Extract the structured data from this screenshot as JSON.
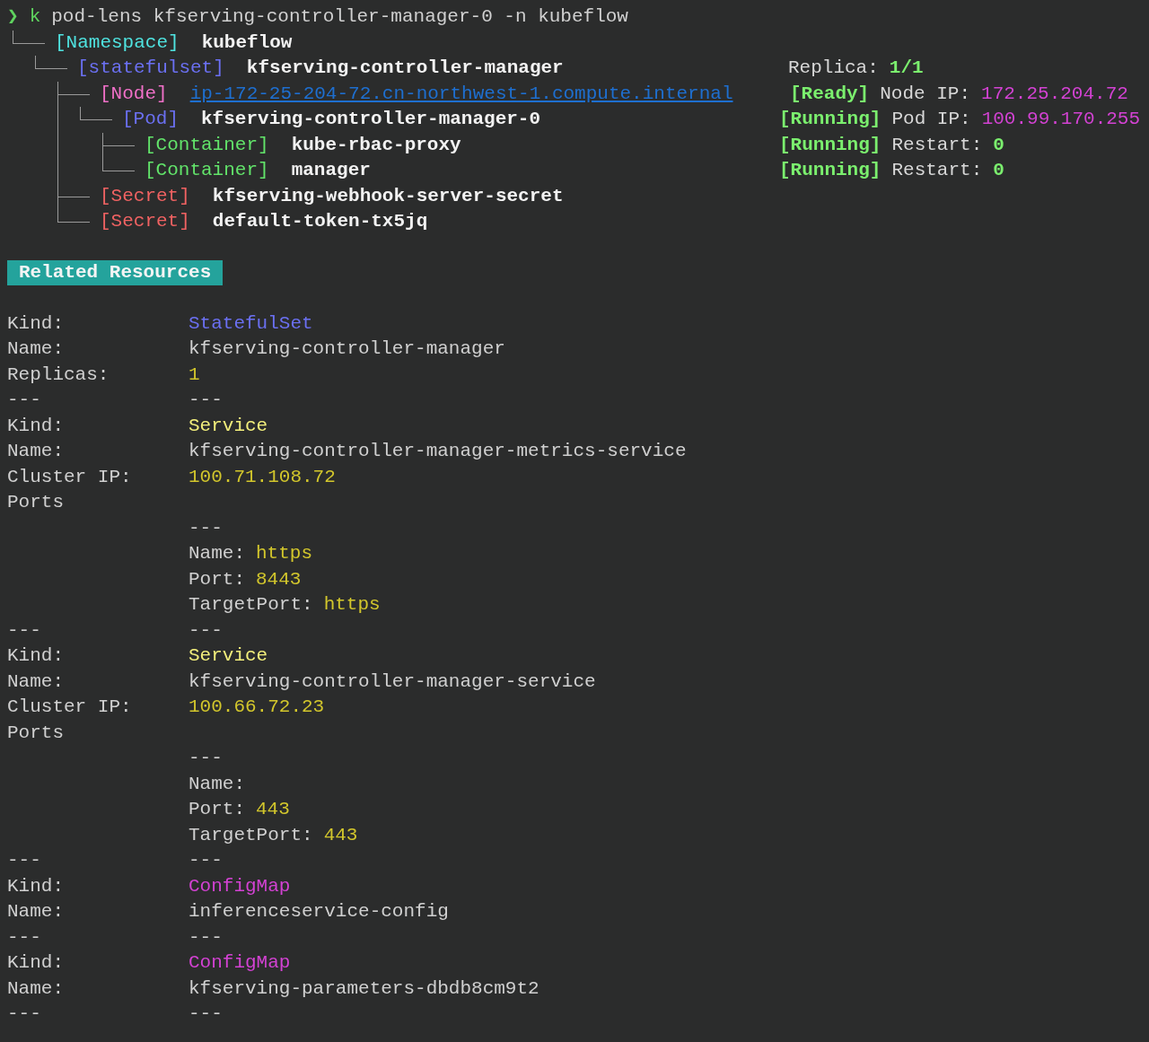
{
  "prompt": {
    "symbol": "❯",
    "alias": "k",
    "command": "pod-lens kfserving-controller-manager-0 -n kubeflow"
  },
  "tree": [
    {
      "kind": "namespace",
      "tag": "[Namespace]",
      "name": "kubeflow",
      "children": [
        {
          "kind": "statefulset",
          "tag": "[statefulset]",
          "name": "kfserving-controller-manager",
          "status": {
            "label": "Replica:",
            "value": "1/1"
          },
          "children": [
            {
              "kind": "node",
              "tag": "[Node]",
              "name": "ip-172-25-204-72.cn-northwest-1.compute.internal",
              "link": true,
              "status": {
                "badge": "[Ready]",
                "label": "Node IP:",
                "value": "172.25.204.72"
              },
              "children": [
                {
                  "kind": "pod",
                  "tag": "[Pod]",
                  "name": "kfserving-controller-manager-0",
                  "status": {
                    "badge": "[Running]",
                    "label": "Pod IP:",
                    "value": "100.99.170.255"
                  },
                  "children": [
                    {
                      "kind": "container",
                      "tag": "[Container]",
                      "name": "kube-rbac-proxy",
                      "status": {
                        "badge": "[Running]",
                        "label": "Restart:",
                        "value": "0"
                      }
                    },
                    {
                      "kind": "container",
                      "tag": "[Container]",
                      "name": "manager",
                      "status": {
                        "badge": "[Running]",
                        "label": "Restart:",
                        "value": "0"
                      }
                    }
                  ]
                }
              ]
            },
            {
              "kind": "secret",
              "tag": "[Secret]",
              "name": "kfserving-webhook-server-secret"
            },
            {
              "kind": "secret",
              "tag": "[Secret]",
              "name": "default-token-tx5jq"
            }
          ]
        }
      ]
    }
  ],
  "related_resources": {
    "title": "Related Resources",
    "items": [
      {
        "fields": [
          {
            "label": "Kind:",
            "value": "StatefulSet",
            "kind": "kind",
            "color": "#6b70f2"
          },
          {
            "label": "Name:",
            "value": "kfserving-controller-manager",
            "kind": "name"
          },
          {
            "label": "Replicas:",
            "value": "1",
            "kind": "number"
          }
        ],
        "separator": [
          "---",
          "---"
        ]
      },
      {
        "fields": [
          {
            "label": "Kind:",
            "value": "Service",
            "kind": "kind",
            "color": "#f3ef7c"
          },
          {
            "label": "Name:",
            "value": "kfserving-controller-manager-metrics-service",
            "kind": "name"
          },
          {
            "label": "Cluster IP:",
            "value": "100.71.108.72",
            "kind": "number"
          }
        ],
        "ports": {
          "label": "Ports",
          "items": [
            {
              "separator": "---",
              "fields": [
                {
                  "label": "Name:",
                  "value": "https"
                },
                {
                  "label": "Port:",
                  "value": "8443"
                },
                {
                  "label": "TargetPort:",
                  "value": "https"
                }
              ]
            }
          ]
        },
        "separator": [
          "---",
          "---"
        ]
      },
      {
        "fields": [
          {
            "label": "Kind:",
            "value": "Service",
            "kind": "kind",
            "color": "#f3ef7c"
          },
          {
            "label": "Name:",
            "value": "kfserving-controller-manager-service",
            "kind": "name"
          },
          {
            "label": "Cluster IP:",
            "value": "100.66.72.23",
            "kind": "number"
          }
        ],
        "ports": {
          "label": "Ports",
          "items": [
            {
              "separator": "---",
              "fields": [
                {
                  "label": "Name:"
                },
                {
                  "label": "Port:",
                  "value": "443"
                },
                {
                  "label": "TargetPort:",
                  "value": "443"
                }
              ]
            }
          ]
        },
        "separator": [
          "---",
          "---"
        ]
      },
      {
        "fields": [
          {
            "label": "Kind:",
            "value": "ConfigMap",
            "kind": "kind",
            "color": "#d342d3"
          },
          {
            "label": "Name:",
            "value": "inferenceservice-config",
            "kind": "name"
          }
        ],
        "separator": [
          "---",
          "---"
        ]
      },
      {
        "fields": [
          {
            "label": "Kind:",
            "value": "ConfigMap",
            "kind": "kind",
            "color": "#d342d3"
          },
          {
            "label": "Name:",
            "value": "kfserving-parameters-dbdb8cm9t2",
            "kind": "name"
          }
        ],
        "separator": [
          "---",
          "---"
        ]
      }
    ]
  }
}
